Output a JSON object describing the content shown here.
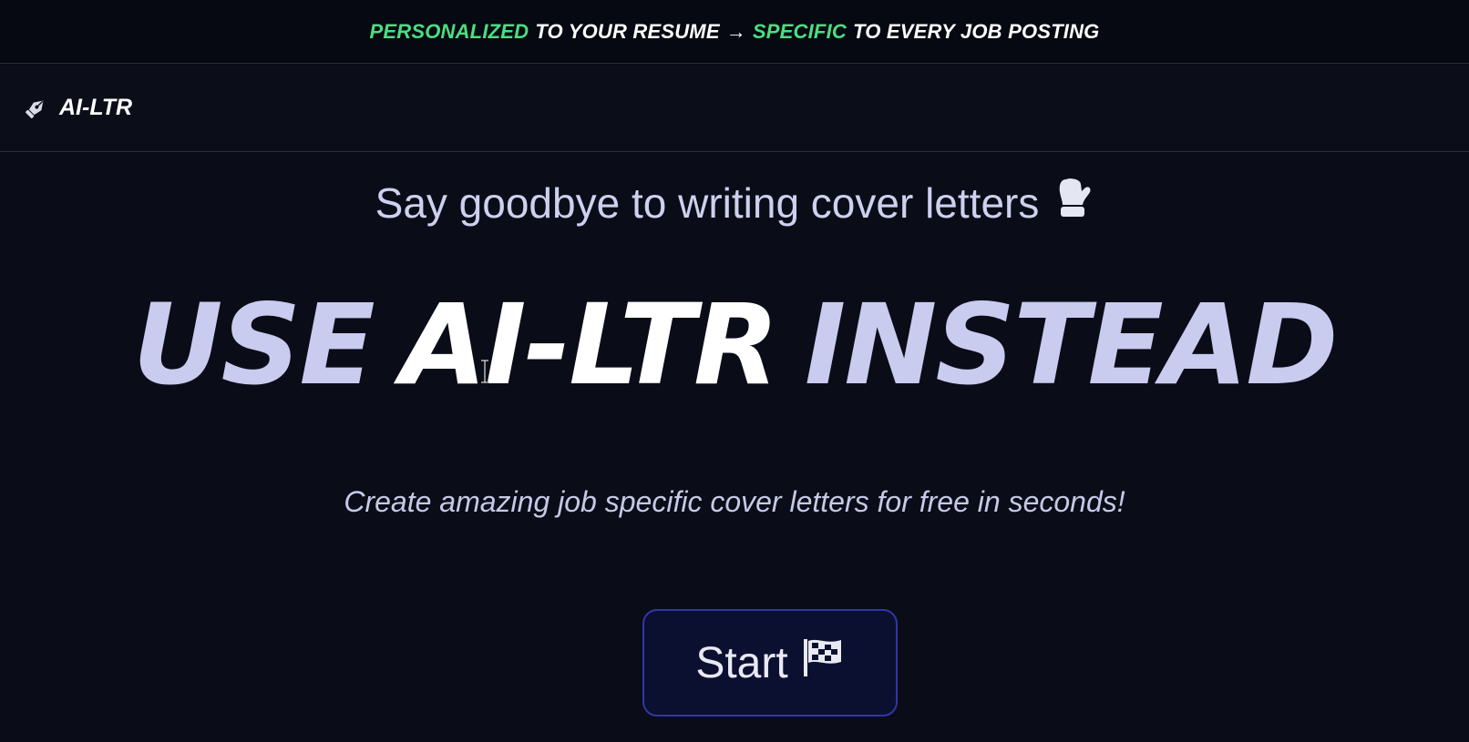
{
  "banner": {
    "part1": "PERSONALIZED",
    "part2": "TO YOUR RESUME",
    "arrow": "→",
    "part3": "SPECIFIC",
    "part4": "TO EVERY JOB POSTING",
    "accent_color": "#4ade80"
  },
  "navbar": {
    "brand_icon": "pen-nib-icon",
    "brand_name": "AI-LTR"
  },
  "hero": {
    "subheading": "Say goodbye to writing cover letters",
    "subheading_icon": "mitten-icon",
    "headline_part1": "USE",
    "headline_part2": "AI-LTR",
    "headline_part3": "INSTEAD",
    "tagline": "Create amazing job specific cover letters for free in seconds!",
    "start_label": "Start",
    "start_icon": "checkered-flag-icon",
    "button_border_color": "#2f37a8"
  }
}
